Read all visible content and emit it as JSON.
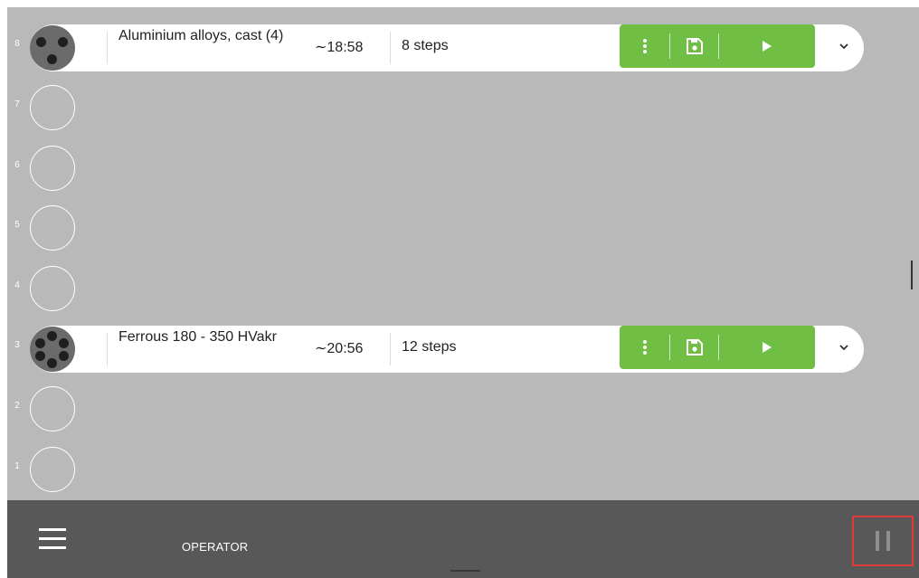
{
  "colors": {
    "background": "#b9b9b9",
    "accent_green": "#71be45",
    "bottom_bar": "#585858",
    "highlight_border": "#e23b3b"
  },
  "slots": [
    {
      "number": "8",
      "occupied": true,
      "holder_icon": "holder-3-icon",
      "program": {
        "name": "Aluminium alloys, cast (4)",
        "time": "∼18:58",
        "steps": "8 steps",
        "menu_icon": "more-vertical-icon",
        "save_icon": "save-icon",
        "play_icon": "play-icon",
        "expand_icon": "chevron-down-icon"
      }
    },
    {
      "number": "7",
      "occupied": false
    },
    {
      "number": "6",
      "occupied": false
    },
    {
      "number": "5",
      "occupied": false
    },
    {
      "number": "4",
      "occupied": false
    },
    {
      "number": "3",
      "occupied": true,
      "holder_icon": "holder-6-icon",
      "program": {
        "name": "Ferrous 180 - 350 HVakr",
        "time": "∼20:56",
        "steps": "12 steps",
        "menu_icon": "more-vertical-icon",
        "save_icon": "save-icon",
        "play_icon": "play-icon",
        "expand_icon": "chevron-down-icon"
      }
    },
    {
      "number": "2",
      "occupied": false
    },
    {
      "number": "1",
      "occupied": false
    }
  ],
  "bottom_bar": {
    "menu_icon": "hamburger-menu-icon",
    "user_role": "OPERATOR",
    "pause_icon": "pause-icon"
  }
}
